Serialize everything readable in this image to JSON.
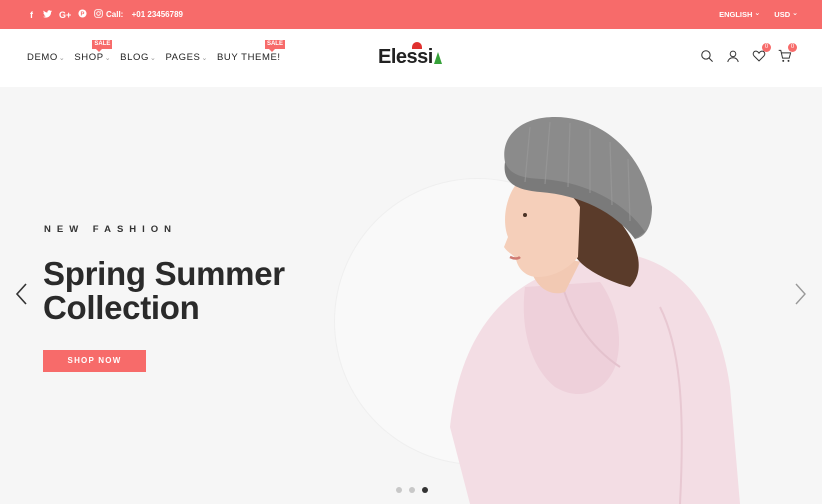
{
  "topbar": {
    "socials": [
      {
        "icon": "facebook-icon",
        "glyph": "f"
      },
      {
        "icon": "twitter-icon",
        "glyph": "t"
      },
      {
        "icon": "google-plus-icon",
        "glyph": "G+"
      },
      {
        "icon": "pinterest-icon",
        "glyph": "P"
      },
      {
        "icon": "instagram-icon",
        "glyph": "◎"
      }
    ],
    "call_label": "Call:",
    "phone": "+01 23456789",
    "language": "ENGLISH",
    "currency": "USD",
    "color": "#f76b6a"
  },
  "nav": {
    "items": [
      {
        "label": "DEMO"
      },
      {
        "label": "SHOP",
        "badge": "SALE"
      },
      {
        "label": "BLOG"
      },
      {
        "label": "PAGES"
      },
      {
        "label": "BUY THEME!",
        "badge": "SALE"
      }
    ]
  },
  "logo": {
    "text": "Elessi"
  },
  "header_icons": {
    "search": "search-icon",
    "account": "user-icon",
    "wishlist": "heart-icon",
    "wishlist_count": "0",
    "cart": "cart-icon",
    "cart_count": "0"
  },
  "hero": {
    "kicker": "NEW FASHION",
    "title_line1": "Spring Summer",
    "title_line2": "Collection",
    "button": "SHOP NOW",
    "slides_total": 3,
    "active_slide": 3
  }
}
